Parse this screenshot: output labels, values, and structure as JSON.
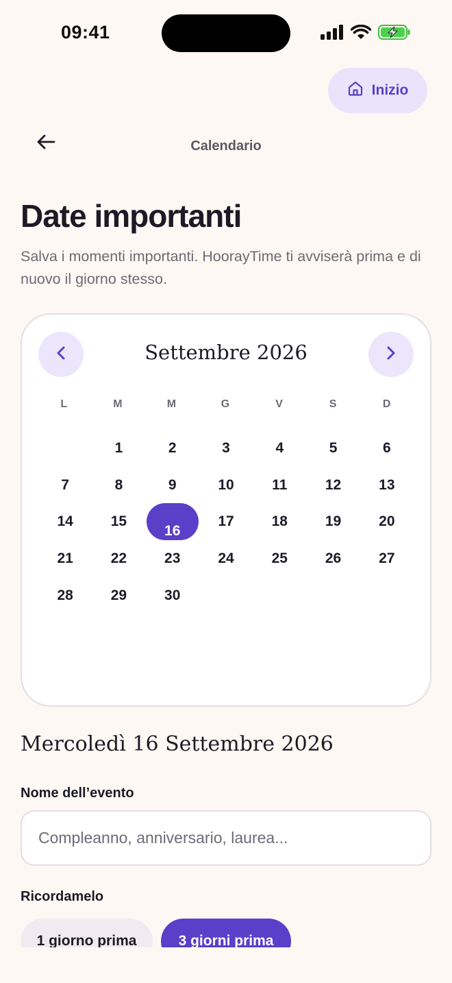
{
  "status_bar": {
    "time": "09:41"
  },
  "home_button": {
    "label": "Inizio"
  },
  "nav": {
    "title": "Calendario"
  },
  "page": {
    "title": "Date importanti",
    "subtitle": "Salva i momenti importanti. HoorayTime ti avviserà prima e di nuovo il giorno stesso."
  },
  "calendar": {
    "month_label": "Settembre 2026",
    "weekdays": [
      "L",
      "M",
      "M",
      "G",
      "V",
      "S",
      "D"
    ],
    "leading_blank_days": 1,
    "days": [
      "1",
      "2",
      "3",
      "4",
      "5",
      "6",
      "7",
      "8",
      "9",
      "10",
      "11",
      "12",
      "13",
      "14",
      "15",
      "16",
      "17",
      "18",
      "19",
      "20",
      "21",
      "22",
      "23",
      "24",
      "25",
      "26",
      "27",
      "28",
      "29",
      "30"
    ],
    "selected_day": "16",
    "accent_color": "#5a3fc8"
  },
  "selected_date_label": "Mercoledì 16 Settembre 2026",
  "event_field": {
    "label": "Nome dell’evento",
    "value": "",
    "placeholder": "Compleanno, anniversario, laurea..."
  },
  "reminder": {
    "label": "Ricordamelo",
    "options": [
      "1 giorno prima",
      "3 giorni prima"
    ],
    "selected": "3 giorni prima"
  }
}
